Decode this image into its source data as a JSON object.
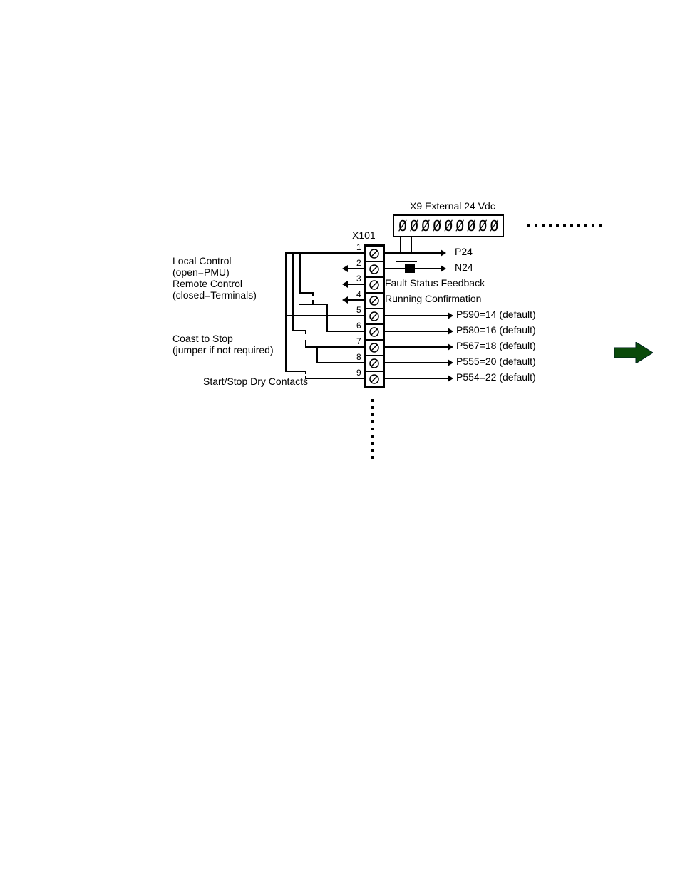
{
  "header": {
    "x9_title": "X9 External 24 Vdc",
    "x101_label": "X101"
  },
  "left_labels": {
    "local_l1": "Local Control",
    "local_l2": "(open=PMU)",
    "remote_l1": "Remote Control",
    "remote_l2": "(closed=Terminals)",
    "coast_l1": "Coast to Stop",
    "coast_l2": "(jumper if not required)",
    "start_stop": "Start/Stop Dry Contacts"
  },
  "terminal_numbers": {
    "t1": "1",
    "t2": "2",
    "t3": "3",
    "t4": "4",
    "t5": "5",
    "t6": "6",
    "t7": "7",
    "t8": "8",
    "t9": "9"
  },
  "right_labels": {
    "p24": "P24",
    "n24": "N24",
    "fault": "Fault Status Feedback",
    "running": "Running Confirmation",
    "p590": "P590=14 (default)",
    "p580": "P580=16 (default)",
    "p567": "P567=18 (default)",
    "p555": "P555=20 (default)",
    "p554": "P554=22 (default)"
  }
}
